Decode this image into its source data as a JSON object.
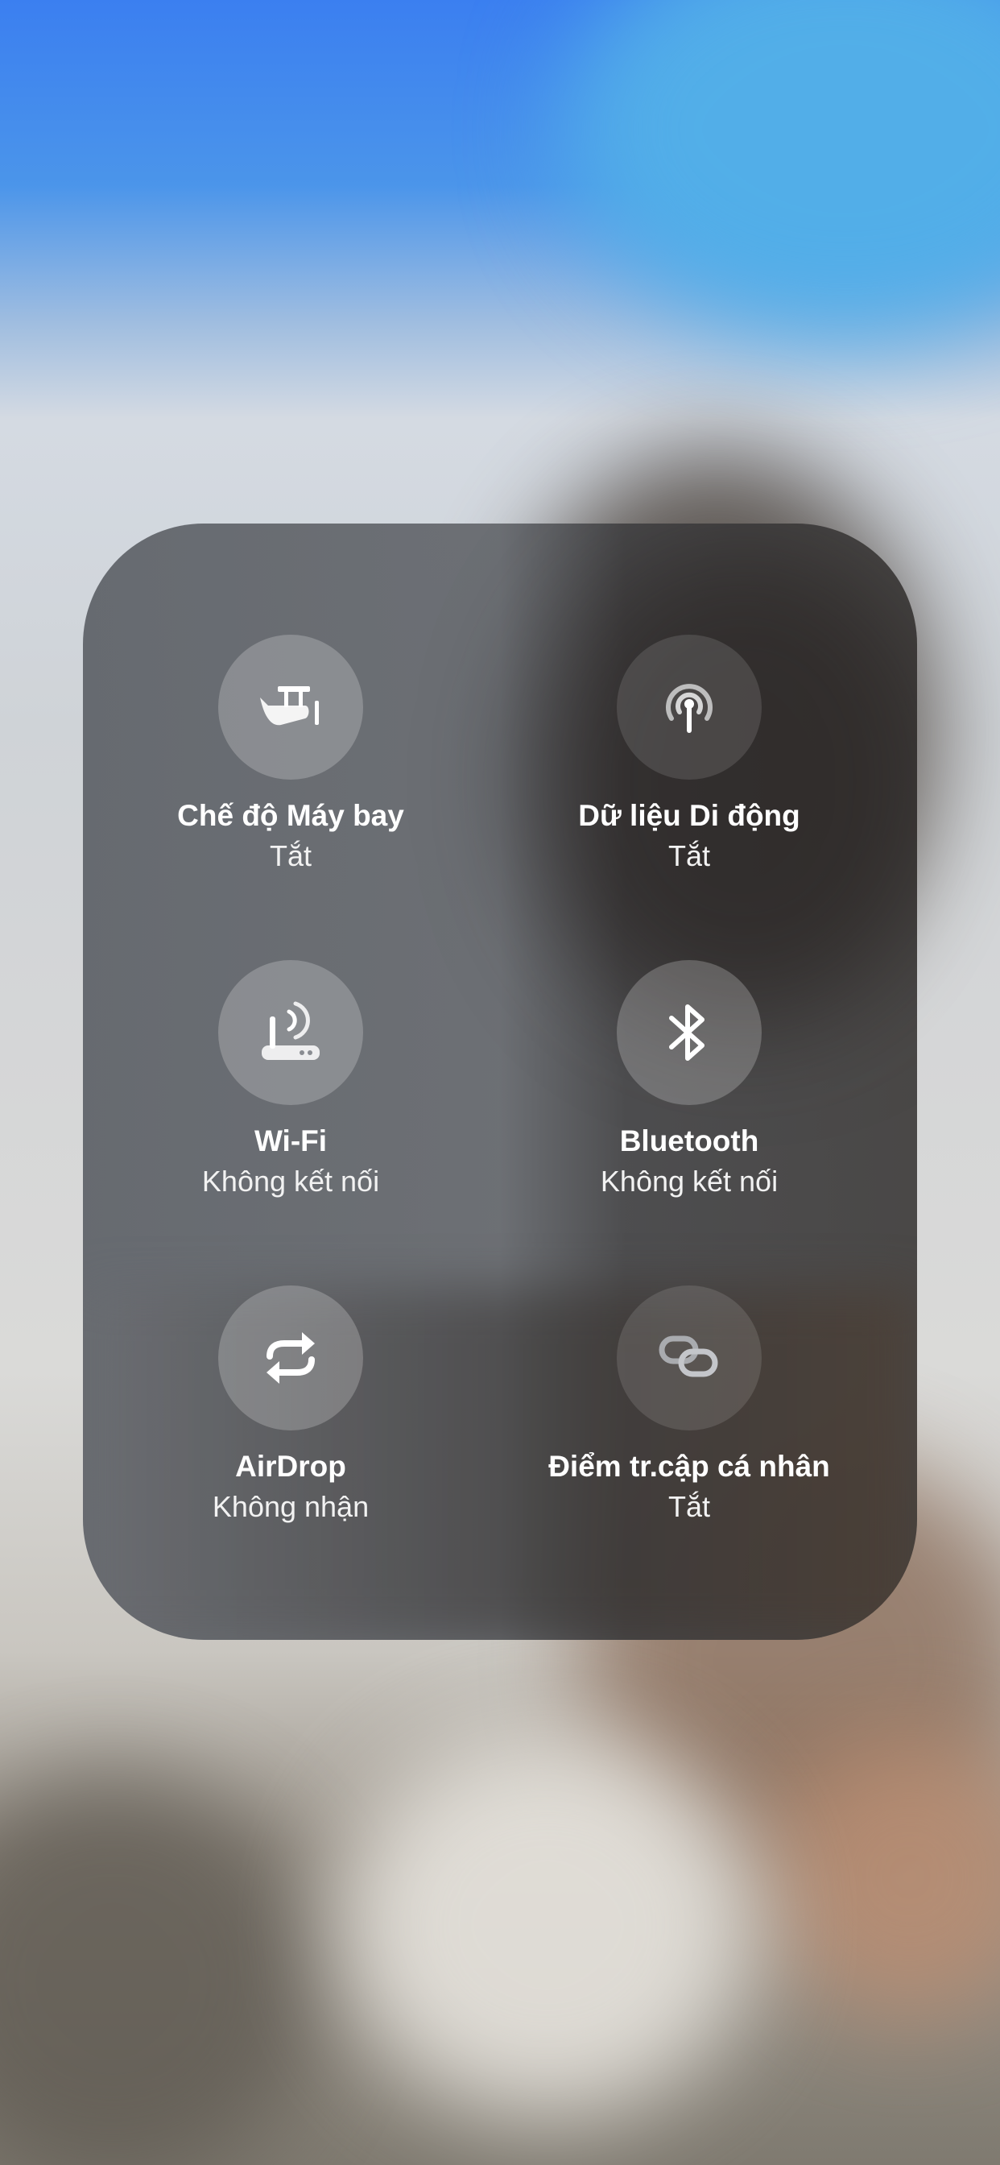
{
  "connectivity": {
    "airplane_mode": {
      "title": "Chế độ Máy bay",
      "status": "Tắt",
      "icon": "airplane-icon"
    },
    "cellular_data": {
      "title": "Dữ liệu Di động",
      "status": "Tắt",
      "icon": "cellular-antenna-icon"
    },
    "wifi": {
      "title": "Wi-Fi",
      "status": "Không kết nối",
      "icon": "wifi-router-icon"
    },
    "bluetooth": {
      "title": "Bluetooth",
      "status": "Không kết nối",
      "icon": "bluetooth-icon"
    },
    "airdrop": {
      "title": "AirDrop",
      "status": "Không nhận",
      "icon": "airdrop-icon"
    },
    "personal_hotspot": {
      "title": "Điểm tr.cập cá nhân",
      "status": "Tắt",
      "icon": "hotspot-link-icon"
    }
  },
  "colors": {
    "panel": "#626670",
    "button_circle": "#8a8d92",
    "text": "#ffffff"
  }
}
